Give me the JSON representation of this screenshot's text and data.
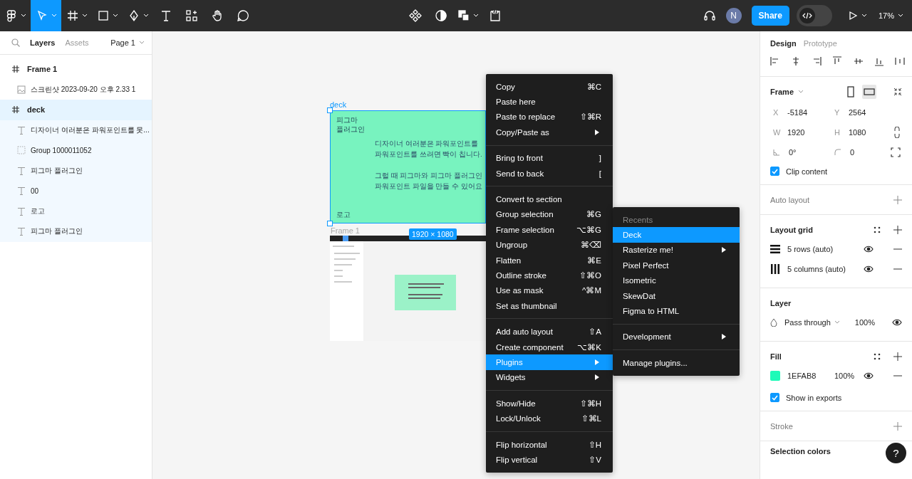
{
  "toolbar": {
    "tools": [
      {
        "kind": "main-menu",
        "selected": false,
        "dropdown": true
      },
      {
        "kind": "move",
        "selected": true,
        "dropdown": true
      },
      {
        "kind": "frame",
        "selected": false,
        "dropdown": true
      },
      {
        "kind": "shape",
        "selected": false,
        "dropdown": true
      },
      {
        "kind": "pen",
        "selected": false,
        "dropdown": true
      },
      {
        "kind": "text",
        "selected": false,
        "dropdown": false
      },
      {
        "kind": "resources",
        "selected": false,
        "dropdown": false
      },
      {
        "kind": "hand",
        "selected": false,
        "dropdown": false
      },
      {
        "kind": "comment",
        "selected": false,
        "dropdown": false
      }
    ],
    "center_tools": [
      {
        "kind": "component",
        "dropdown": false
      },
      {
        "kind": "mask",
        "dropdown": false
      },
      {
        "kind": "boolean",
        "dropdown": true
      },
      {
        "kind": "code",
        "dropdown": false
      }
    ],
    "avatar": "N",
    "share": "Share",
    "dev_mode": {
      "on": false
    },
    "zoom": "17%"
  },
  "left_panel": {
    "tabs": [
      {
        "label": "Layers",
        "selected": true
      },
      {
        "label": "Assets",
        "selected": false
      }
    ],
    "page": "Page 1",
    "layers": [
      {
        "name": "Frame 1",
        "kind": "frame",
        "selected": false,
        "children": [
          {
            "name": "스크린샷 2023-09-20 오후 2.33 1",
            "kind": "image"
          }
        ]
      },
      {
        "name": "deck",
        "kind": "frame",
        "selected": true,
        "children": [
          {
            "name": "디자이너 여러분은 파워포인트를 못...",
            "kind": "text"
          },
          {
            "name": "Group 1000011052",
            "kind": "group"
          },
          {
            "name": "피그마 플러그인",
            "kind": "text"
          },
          {
            "name": "00",
            "kind": "text"
          },
          {
            "name": "로고",
            "kind": "text"
          },
          {
            "name": "피그마 플러그인",
            "kind": "text"
          }
        ]
      }
    ]
  },
  "canvas": {
    "deck_label": "deck",
    "deck_frame": {
      "title": "피그마\n플러그인",
      "paragraphs": [
        [
          "디자이너 여러분은 파워포인트를",
          "파워포인트를 쓰려면 빡이 칩니다."
        ],
        [
          "그럴 때 피그마와 피그마 플러그인",
          "파워포인트 파일을 만들 수 있어요"
        ]
      ],
      "logo": "로고"
    },
    "frame1_label": "Frame 1",
    "size_badge": "1920 × 1080"
  },
  "context_menu": {
    "groups": [
      [
        {
          "label": "Copy",
          "shortcut": "⌘C",
          "submenu": false,
          "selected": false
        },
        {
          "label": "Paste here",
          "submenu": false,
          "selected": false
        },
        {
          "label": "Paste to replace",
          "shortcut": "⇧⌘R",
          "submenu": false,
          "selected": false
        },
        {
          "label": "Copy/Paste as",
          "submenu": true,
          "selected": false
        }
      ],
      [
        {
          "label": "Bring to front",
          "shortcut": "]",
          "submenu": false,
          "selected": false
        },
        {
          "label": "Send to back",
          "shortcut": "[",
          "submenu": false,
          "selected": false
        }
      ],
      [
        {
          "label": "Convert to section",
          "submenu": false,
          "selected": false
        },
        {
          "label": "Group selection",
          "shortcut": "⌘G",
          "submenu": false,
          "selected": false
        },
        {
          "label": "Frame selection",
          "shortcut": "⌥⌘G",
          "submenu": false,
          "selected": false
        },
        {
          "label": "Ungroup",
          "shortcut": "⌘⌫",
          "submenu": false,
          "selected": false
        },
        {
          "label": "Flatten",
          "shortcut": "⌘E",
          "submenu": false,
          "selected": false
        },
        {
          "label": "Outline stroke",
          "shortcut": "⇧⌘O",
          "submenu": false,
          "selected": false
        },
        {
          "label": "Use as mask",
          "shortcut": "^⌘M",
          "submenu": false,
          "selected": false
        },
        {
          "label": "Set as thumbnail",
          "submenu": false,
          "selected": false
        }
      ],
      [
        {
          "label": "Add auto layout",
          "shortcut": "⇧A",
          "submenu": false,
          "selected": false
        },
        {
          "label": "Create component",
          "shortcut": "⌥⌘K",
          "submenu": false,
          "selected": false
        },
        {
          "label": "Plugins",
          "submenu": true,
          "selected": true
        },
        {
          "label": "Widgets",
          "submenu": true,
          "selected": false
        }
      ],
      [
        {
          "label": "Show/Hide",
          "shortcut": "⇧⌘H",
          "submenu": false,
          "selected": false
        },
        {
          "label": "Lock/Unlock",
          "shortcut": "⇧⌘L",
          "submenu": false,
          "selected": false
        }
      ],
      [
        {
          "label": "Flip horizontal",
          "shortcut": "⇧H",
          "submenu": false,
          "selected": false
        },
        {
          "label": "Flip vertical",
          "shortcut": "⇧V",
          "submenu": false,
          "selected": false
        }
      ]
    ]
  },
  "plugins_submenu": {
    "header": "Recents",
    "groups": [
      [
        {
          "label": "Deck",
          "submenu": false,
          "selected": true
        },
        {
          "label": "Rasterize me!",
          "submenu": true,
          "selected": false
        },
        {
          "label": "Pixel Perfect",
          "submenu": false,
          "selected": false
        },
        {
          "label": "Isometric",
          "submenu": false,
          "selected": false
        },
        {
          "label": "SkewDat",
          "submenu": false,
          "selected": false
        },
        {
          "label": "Figma to HTML",
          "submenu": false,
          "selected": false
        }
      ],
      [
        {
          "label": "Development",
          "submenu": true,
          "selected": false
        }
      ],
      [
        {
          "label": "Manage plugins...",
          "submenu": false,
          "selected": false
        }
      ]
    ]
  },
  "right_panel": {
    "tabs": [
      {
        "label": "Design",
        "selected": true
      },
      {
        "label": "Prototype",
        "selected": false
      }
    ],
    "frame": {
      "title": "Frame",
      "orientation": [
        {
          "kind": "portrait",
          "selected": false
        },
        {
          "kind": "landscape",
          "selected": true
        }
      ],
      "fields": [
        {
          "label": "X",
          "value": "-5184"
        },
        {
          "label": "Y",
          "value": "2564"
        },
        {
          "label": "W",
          "value": "1920"
        },
        {
          "label": "H",
          "value": "1080"
        },
        {
          "kind": "rotation",
          "value": "0°"
        },
        {
          "kind": "radius",
          "value": "0"
        }
      ],
      "clip_content": {
        "label": "Clip content",
        "checked": true
      }
    },
    "auto_layout": "Auto layout",
    "layout_grid": {
      "title": "Layout grid",
      "grids": [
        {
          "kind": "rows",
          "label": "5 rows (auto)"
        },
        {
          "kind": "columns",
          "label": "5 columns (auto)"
        }
      ]
    },
    "layer": {
      "title": "Layer",
      "blend": "Pass through",
      "opacity": "100%"
    },
    "fill": {
      "title": "Fill",
      "hex": "1EFAB8",
      "opacity": "100%",
      "show_in_exports": {
        "label": "Show in exports",
        "checked": true
      }
    },
    "stroke": "Stroke",
    "selection_colors": "Selection colors"
  },
  "help": "?"
}
